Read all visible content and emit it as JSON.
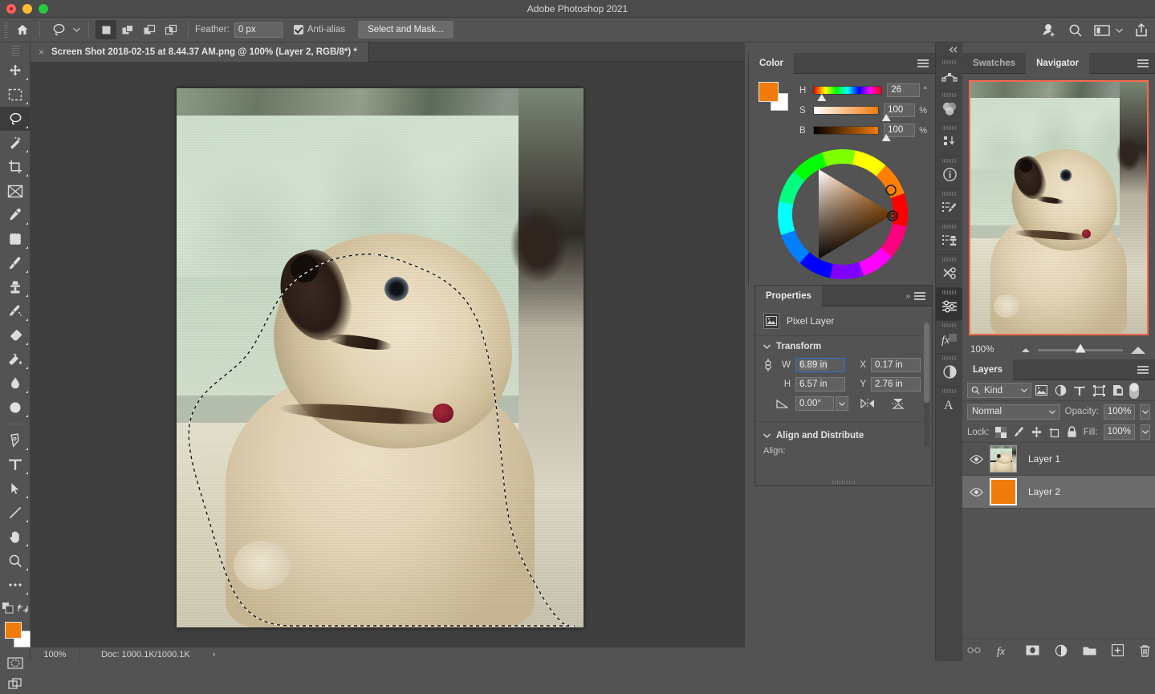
{
  "window": {
    "title": "Adobe Photoshop 2021"
  },
  "options_bar": {
    "home_icon": "home-icon",
    "tool_icon": "lasso-tool-icon",
    "selection_modes": [
      {
        "name": "new-selection",
        "active": true
      },
      {
        "name": "add-to-selection",
        "active": false
      },
      {
        "name": "subtract-from-selection",
        "active": false
      },
      {
        "name": "intersect-with-selection",
        "active": false
      }
    ],
    "feather_label": "Feather:",
    "feather_value": "0 px",
    "antialias_label": "Anti-alias",
    "antialias_checked": true,
    "select_and_mask_label": "Select and Mask...",
    "right_icons": [
      "add-user-icon",
      "search-icon",
      "workspace-icon",
      "chevron-down-icon",
      "share-icon"
    ]
  },
  "toolbar": {
    "tools": [
      {
        "name": "move-tool",
        "active": false
      },
      {
        "name": "rectangular-marquee-tool",
        "active": false
      },
      {
        "name": "lasso-tool",
        "active": true
      },
      {
        "name": "magic-wand-tool",
        "active": false
      },
      {
        "name": "crop-tool",
        "active": false
      },
      {
        "name": "frame-tool",
        "active": false
      },
      {
        "name": "eyedropper-tool",
        "active": false
      },
      {
        "name": "spot-healing-brush-tool",
        "active": false
      },
      {
        "name": "brush-tool",
        "active": false
      },
      {
        "name": "clone-stamp-tool",
        "active": false
      },
      {
        "name": "history-brush-tool",
        "active": false
      },
      {
        "name": "eraser-tool",
        "active": false
      },
      {
        "name": "gradient-tool",
        "active": false
      },
      {
        "name": "blur-tool",
        "active": false
      },
      {
        "name": "dodge-tool",
        "active": false
      },
      {
        "name": "pen-tool",
        "active": false
      },
      {
        "name": "type-tool",
        "active": false
      },
      {
        "name": "path-selection-tool",
        "active": false
      },
      {
        "name": "line-tool",
        "active": false
      },
      {
        "name": "hand-tool",
        "active": false
      },
      {
        "name": "zoom-tool",
        "active": false
      },
      {
        "name": "edit-toolbar-tool",
        "active": false
      }
    ],
    "foreground_color": "#f07b0a",
    "background_color": "#ffffff"
  },
  "document": {
    "tab_title": "Screen Shot 2018-02-15 at 8.44.37 AM.png @ 100% (Layer 2, RGB/8*) *",
    "close_glyph": "×"
  },
  "status_bar": {
    "zoom": "100%",
    "doc_info": "Doc: 1000.1K/1000.1K",
    "arrow": "›"
  },
  "color_panel": {
    "tab_label": "Color",
    "sliders": [
      {
        "label": "H",
        "value": "26",
        "unit": "°",
        "thumb_pct": 8
      },
      {
        "label": "S",
        "value": "100",
        "unit": "%",
        "thumb_pct": 94
      },
      {
        "label": "B",
        "value": "100",
        "unit": "%",
        "thumb_pct": 94
      }
    ],
    "foreground": "#f07b0a",
    "background": "#ffffff"
  },
  "properties_panel": {
    "tab_label": "Properties",
    "layer_type": "Pixel Layer",
    "transform_label": "Transform",
    "fields": {
      "w_label": "W",
      "w_value": "6.89 in",
      "h_label": "H",
      "h_value": "6.57 in",
      "x_label": "X",
      "x_value": "0.17 in",
      "y_label": "Y",
      "y_value": "2.76 in",
      "angle_value": "0.00°"
    },
    "align_section_label": "Align and Distribute",
    "align_label": "Align:"
  },
  "navigator_panel": {
    "tabs": [
      {
        "label": "Swatches",
        "active": false
      },
      {
        "label": "Navigator",
        "active": true
      }
    ],
    "zoom": "100%",
    "view_rect_color": "#ff6a4d"
  },
  "layers_panel": {
    "tab_label": "Layers",
    "filter_label": "Kind",
    "filter_icons": [
      "pixel-filter-icon",
      "adjustment-filter-icon",
      "type-filter-icon",
      "shape-filter-icon",
      "smart-object-filter-icon"
    ],
    "blend_mode": "Normal",
    "opacity_label": "Opacity:",
    "opacity_value": "100%",
    "lock_label": "Lock:",
    "fill_label": "Fill:",
    "fill_value": "100%",
    "lock_icons": [
      "lock-transparent-pixels-icon",
      "lock-image-pixels-icon",
      "lock-position-icon",
      "lock-artboard-icon",
      "lock-all-icon"
    ],
    "layers": [
      {
        "name": "Layer 1",
        "visible": true,
        "selected": false,
        "thumb": "photo"
      },
      {
        "name": "Layer 2",
        "visible": true,
        "selected": true,
        "thumb": "#f07b0a"
      }
    ],
    "footer_icons": [
      "link-layers-icon",
      "layer-style-fx-icon",
      "add-layer-mask-icon",
      "new-adjustment-layer-icon",
      "new-group-icon",
      "new-layer-icon",
      "delete-layer-icon"
    ]
  },
  "right_rail": {
    "collapse_glyph": "«",
    "icons": [
      {
        "name": "paths-panel-icon",
        "active": false
      },
      {
        "name": "color-wheel-panel-icon",
        "active": false
      },
      {
        "name": "history-panel-icon",
        "active": false
      },
      {
        "name": "info-panel-icon",
        "active": false
      },
      {
        "name": "brush-settings-panel-icon",
        "active": false
      },
      {
        "name": "clone-source-panel-icon",
        "active": false
      },
      {
        "name": "tool-presets-panel-icon",
        "active": false
      },
      {
        "name": "adjustments-panel-icon",
        "active": true
      },
      {
        "name": "styles-panel-icon",
        "active": false
      },
      {
        "name": "adjustment-layer-panel-icon",
        "active": false
      },
      {
        "name": "character-panel-icon",
        "active": false
      }
    ]
  }
}
